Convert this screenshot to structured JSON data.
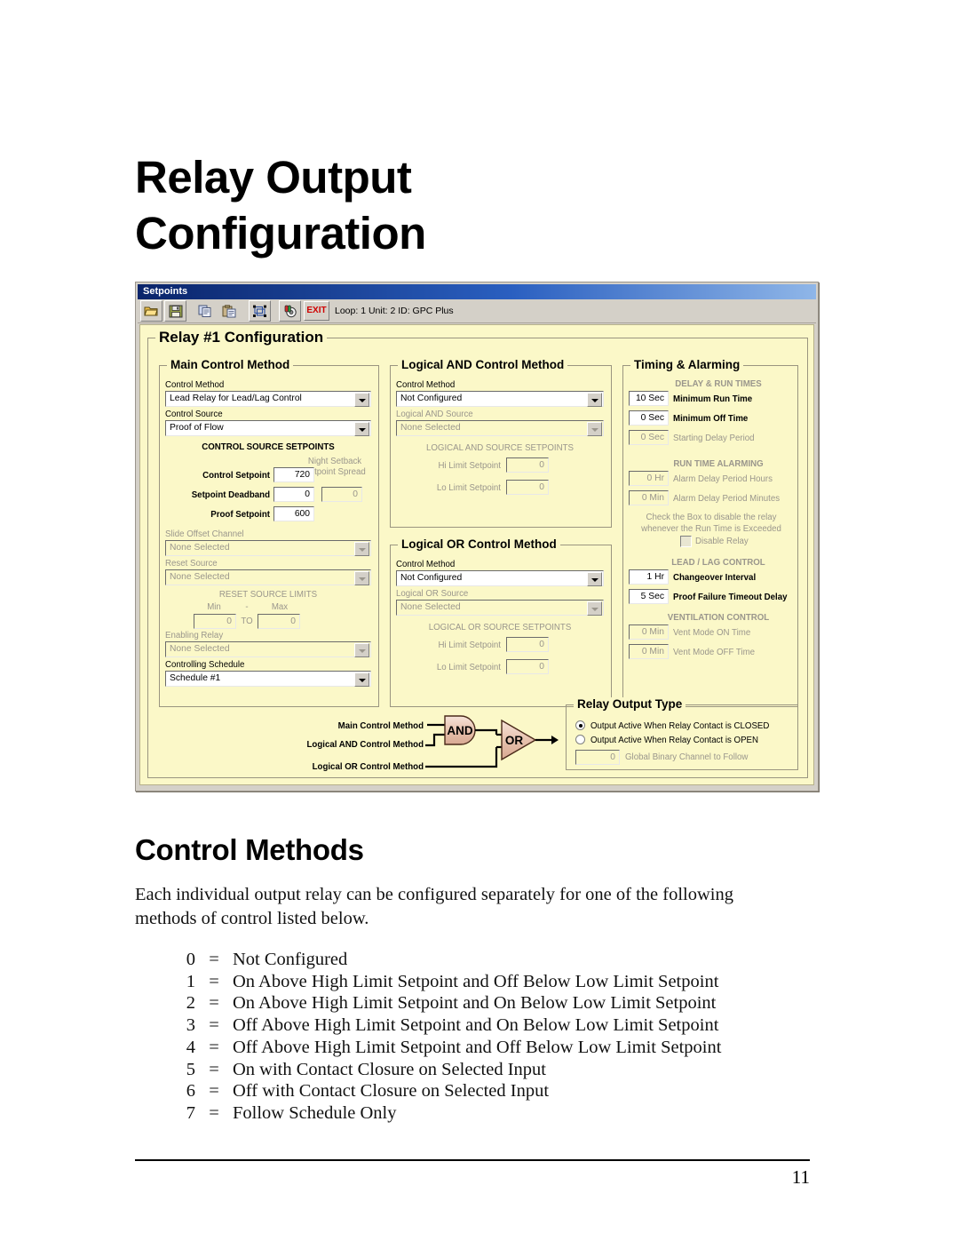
{
  "document": {
    "title_line1": "Relay Output",
    "title_line2": "Configuration",
    "section_heading": "Control Methods",
    "paragraph": "Each individual output relay can be configured separately for one of the following methods of control listed below.",
    "page_number": "11"
  },
  "control_methods": {
    "separator": "=",
    "items": [
      {
        "num": "0",
        "text": "Not Configured"
      },
      {
        "num": "1",
        "text": "On Above High Limit Setpoint and Off Below Low Limit Setpoint"
      },
      {
        "num": "2",
        "text": "On Above High Limit Setpoint and On Below Low Limit Setpoint"
      },
      {
        "num": "3",
        "text": "Off Above High Limit Setpoint and On Below Low Limit Setpoint"
      },
      {
        "num": "4",
        "text": "Off Above High Limit Setpoint and Off Below Low Limit Setpoint"
      },
      {
        "num": "5",
        "text": "On with Contact Closure on Selected Input"
      },
      {
        "num": "6",
        "text": "Off with Contact Closure on Selected Input"
      },
      {
        "num": "7",
        "text": "Follow Schedule Only"
      }
    ]
  },
  "app": {
    "window_title": "Setpoints",
    "toolbar": {
      "icons": [
        {
          "name": "open-folder-icon",
          "tooltip": "Open"
        },
        {
          "name": "save-disk-icon",
          "tooltip": "Save"
        },
        {
          "name": "copy-icon",
          "tooltip": "Copy"
        },
        {
          "name": "paste-icon",
          "tooltip": "Paste"
        },
        {
          "name": "select-objects-icon",
          "tooltip": "Select"
        },
        {
          "name": "communications-icon",
          "tooltip": "Communications"
        }
      ],
      "exit_label": "EXIT",
      "status_text": "Loop: 1  Unit: 2  ID: GPC Plus"
    },
    "panel_title": "Relay #1 Configuration",
    "main_control": {
      "legend": "Main Control Method",
      "control_method_label": "Control Method",
      "control_method_value": "Lead Relay for Lead/Lag Control",
      "control_source_label": "Control Source",
      "control_source_value": "Proof of Flow",
      "setpoints_header": "CONTROL SOURCE SETPOINTS",
      "night_setback_line1": "Night Setback",
      "night_setback_line2": "Setpoint Spread",
      "control_setpoint_label": "Control Setpoint",
      "control_setpoint_value": "720",
      "setpoint_deadband_label": "Setpoint Deadband",
      "setpoint_deadband_value": "0",
      "night_setback_value": "0",
      "proof_setpoint_label": "Proof Setpoint",
      "proof_setpoint_value": "600",
      "slide_offset_label": "Slide Offset Channel",
      "slide_offset_value": "None Selected",
      "reset_source_label": "Reset Source",
      "reset_source_value": "None Selected",
      "reset_limits_header": "RESET SOURCE LIMITS",
      "min_label": "Min",
      "dash_label": "-",
      "max_label": "Max",
      "min_value": "0",
      "to_label": "TO",
      "max_value": "0",
      "enabling_relay_label": "Enabling Relay",
      "enabling_relay_value": "None Selected",
      "controlling_schedule_label": "Controlling Schedule",
      "controlling_schedule_value": "Schedule #1"
    },
    "logical_and": {
      "legend": "Logical AND Control Method",
      "control_method_label": "Control Method",
      "control_method_value": "Not Configured",
      "source_label": "Logical AND Source",
      "source_value": "None Selected",
      "setpoints_header": "LOGICAL AND SOURCE SETPOINTS",
      "hi_limit_label": "Hi Limit Setpoint",
      "hi_limit_value": "0",
      "lo_limit_label": "Lo Limit Setpoint",
      "lo_limit_value": "0"
    },
    "logical_or": {
      "legend": "Logical OR Control Method",
      "control_method_label": "Control Method",
      "control_method_value": "Not Configured",
      "source_label": "Logical OR Source",
      "source_value": "None Selected",
      "setpoints_header": "LOGICAL OR SOURCE SETPOINTS",
      "hi_limit_label": "Hi Limit Setpoint",
      "hi_limit_value": "0",
      "lo_limit_label": "Lo Limit Setpoint",
      "lo_limit_value": "0"
    },
    "timing": {
      "legend": "Timing & Alarming",
      "delay_header": "DELAY & RUN TIMES",
      "min_run_value": "10 Sec",
      "min_run_label": "Minimum Run Time",
      "min_off_value": "0 Sec",
      "min_off_label": "Minimum Off Time",
      "start_delay_value": "0 Sec",
      "start_delay_label": "Starting Delay Period",
      "alarming_header": "RUN TIME ALARMING",
      "alarm_hours_value": "0 Hr",
      "alarm_hours_label": "Alarm Delay Period Hours",
      "alarm_minutes_value": "0 Min",
      "alarm_minutes_label": "Alarm Delay Period Minutes",
      "disable_note_line1": "Check the Box to disable the relay",
      "disable_note_line2": "whenever the Run Time is Exceeded",
      "disable_relay_label": "Disable Relay",
      "leadlag_header": "LEAD / LAG CONTROL",
      "changeover_value": "1 Hr",
      "changeover_label": "Changeover Interval",
      "proof_timeout_value": "5 Sec",
      "proof_timeout_label": "Proof Failure Timeout Delay",
      "ventilation_header": "VENTILATION CONTROL",
      "vent_on_value": "0 Min",
      "vent_on_label": "Vent Mode ON Time",
      "vent_off_value": "0 Min",
      "vent_off_label": "Vent Mode OFF Time"
    },
    "logic_diagram": {
      "main_label": "Main Control Method",
      "and_label": "Logical AND Control Method",
      "or_label": "Logical OR Control Method",
      "and_gate": "AND",
      "or_gate": "OR"
    },
    "relay_output_type": {
      "legend": "Relay Output Type",
      "option_closed": "Output Active When Relay Contact is CLOSED",
      "option_open": "Output Active When Relay Contact is OPEN",
      "global_channel_value": "0",
      "global_channel_label": "Global Binary Channel to Follow"
    }
  },
  "colors": {
    "client_background": "#fbf8c8",
    "window_chrome": "#d4d0c8",
    "titlebar_start": "#0a246a",
    "titlebar_end": "#8fb6e8",
    "exit_red": "#d00000",
    "gate_fill": "#e8c4b0"
  }
}
